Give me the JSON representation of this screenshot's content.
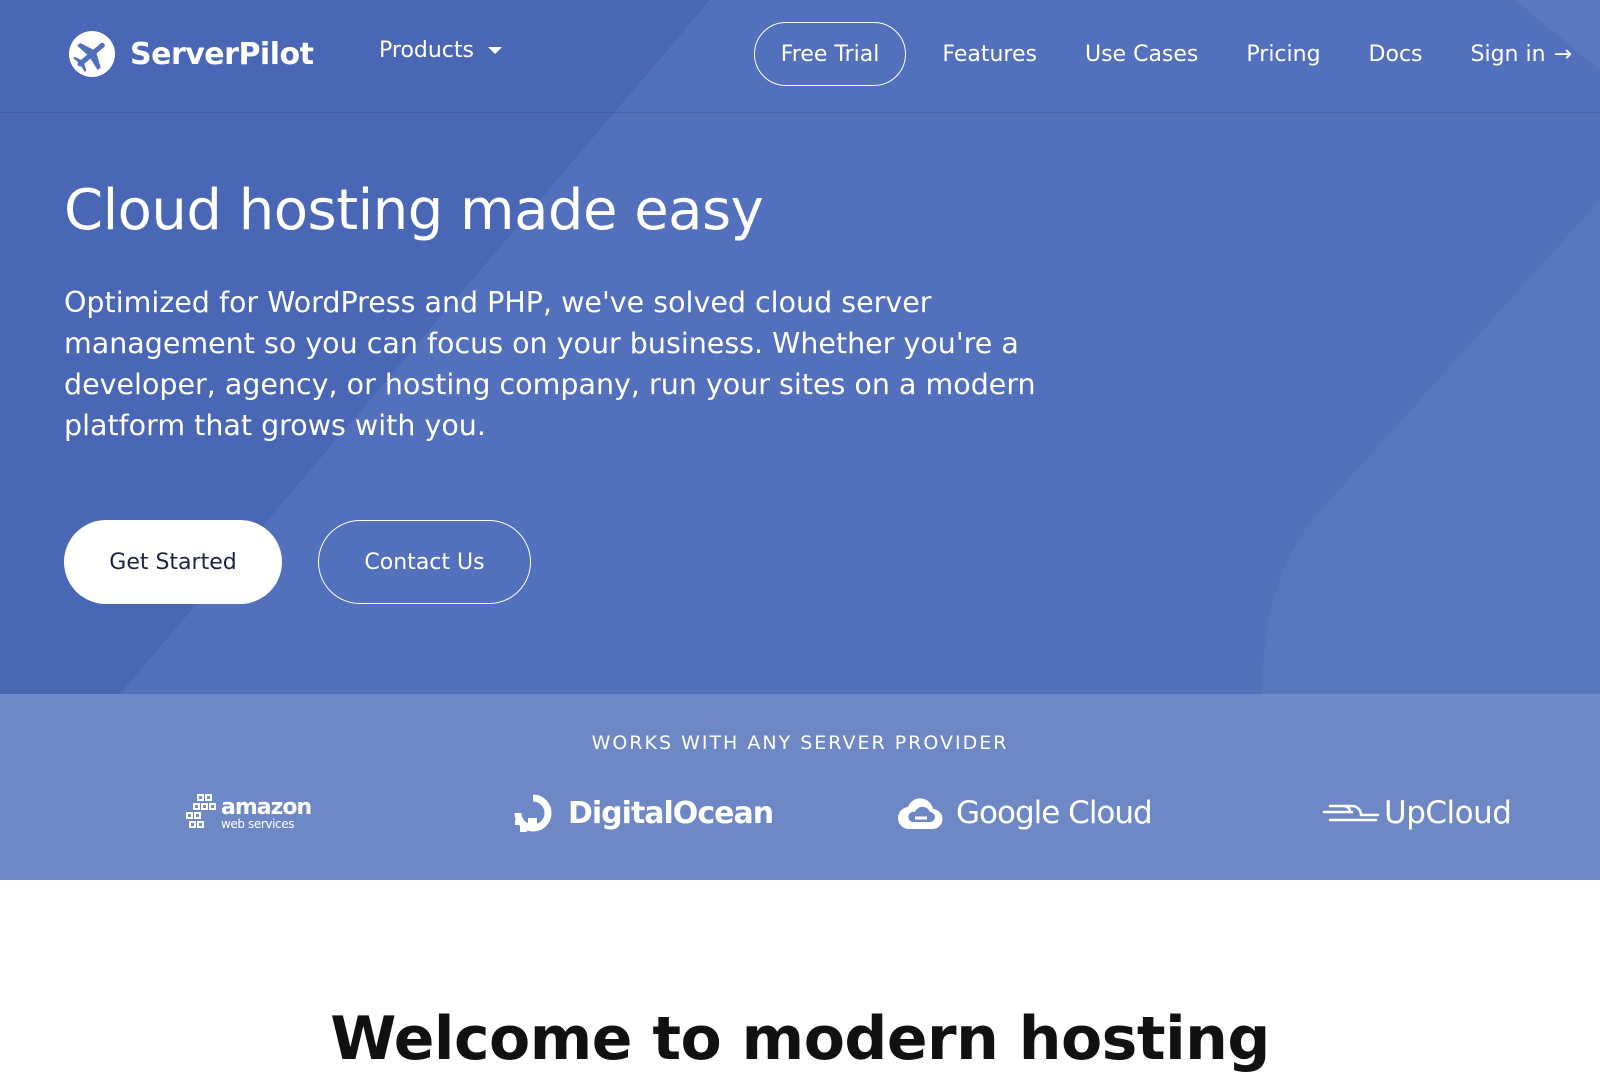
{
  "brand": {
    "name": "ServerPilot",
    "logo_icon": "airplane-logo-icon"
  },
  "nav": {
    "products_label": "Products",
    "free_trial_label": "Free Trial",
    "features_label": "Features",
    "use_cases_label": "Use Cases",
    "pricing_label": "Pricing",
    "docs_label": "Docs",
    "signin_label": "Sign in",
    "signin_arrow": "→"
  },
  "hero": {
    "title": "Cloud hosting made easy",
    "subtitle": "Optimized for WordPress and PHP, we've solved cloud server management so you can focus on your business. Whether you're a developer, agency, or hosting company, run your sites on a modern platform that grows with you.",
    "get_started_label": "Get Started",
    "contact_label": "Contact Us"
  },
  "providers": {
    "heading": "WORKS WITH ANY SERVER PROVIDER",
    "aws": {
      "main": "amazon",
      "sub": "web services"
    },
    "digitalocean": "DigitalOcean",
    "google_cloud": "Google Cloud",
    "upcloud": "UpCloud"
  },
  "welcome": {
    "title": "Welcome to modern hosting"
  },
  "colors": {
    "hero_bg": "#5270bb",
    "providers_bg": "#6e88c5",
    "text_on_blue": "#ffffff"
  }
}
